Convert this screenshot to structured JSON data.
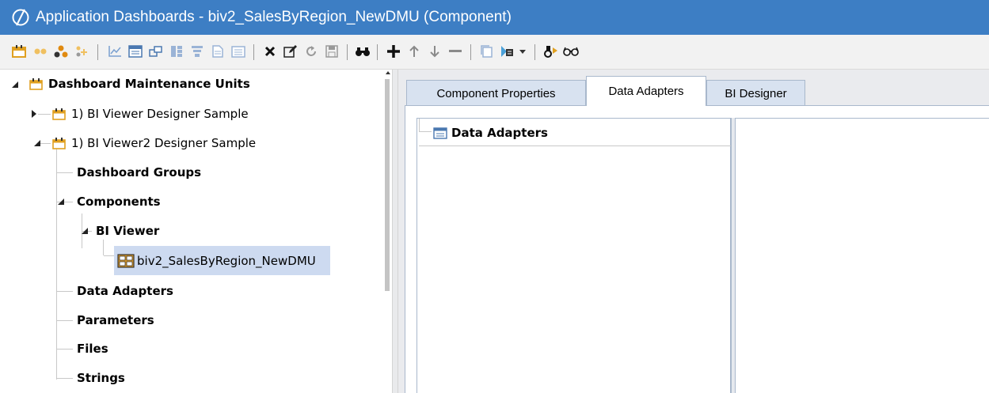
{
  "window": {
    "title": "Application Dashboards - biv2_SalesByRegion_NewDMU (Component)"
  },
  "toolbar": {
    "buttons": [
      "dashboard-maintenance-unit-icon",
      "group-icon",
      "component-group-icon",
      "add-component-icon",
      "chart-icon",
      "data-adapter-icon",
      "parameter-icon",
      "file-icon",
      "filter-icon",
      "document-icon",
      "string-icon",
      "delete-icon",
      "edit-icon",
      "refresh-icon",
      "save-icon",
      "search-binoculars-icon",
      "add-icon",
      "move-up-icon",
      "move-down-icon",
      "remove-icon",
      "copy-icon",
      "view-dashboard-icon",
      "dropdown-arrow-icon",
      "object-lookup-icon",
      "glasses-icon"
    ]
  },
  "tree": {
    "root": {
      "label": "Dashboard Maintenance Units"
    },
    "items": [
      {
        "label": "1) BI Viewer Designer Sample"
      },
      {
        "label": "1) BI Viewer2 Designer Sample"
      },
      {
        "label": "Dashboard Groups"
      },
      {
        "label": "Components"
      },
      {
        "label": "BI Viewer"
      },
      {
        "label": "biv2_SalesByRegion_NewDMU"
      },
      {
        "label": "Data Adapters"
      },
      {
        "label": "Parameters"
      },
      {
        "label": "Files"
      },
      {
        "label": "Strings"
      }
    ]
  },
  "tabs": [
    {
      "label": "Component Properties",
      "active": false
    },
    {
      "label": "Data Adapters",
      "active": true
    },
    {
      "label": "BI Designer",
      "active": false
    }
  ],
  "data_adapters_panel": {
    "root_label": "Data Adapters"
  },
  "colors": {
    "titlebar": "#3d7ec4",
    "folder": "#e0a020",
    "selection": "#cddaf0",
    "tab": "#d8e2f0"
  }
}
